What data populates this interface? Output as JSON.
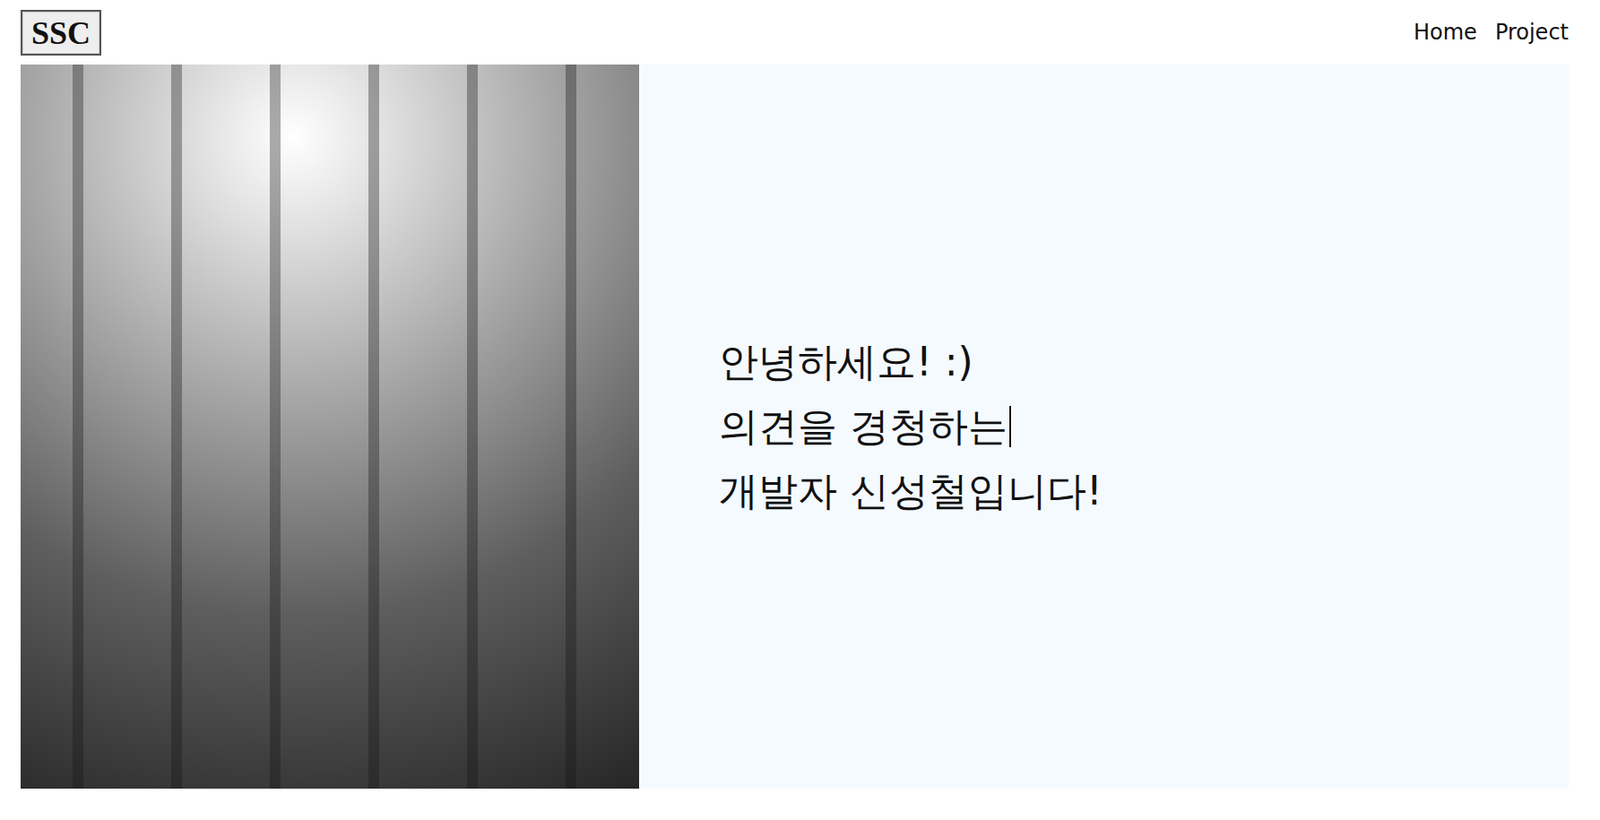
{
  "logo": "SSC",
  "nav": [
    {
      "label": "Home"
    },
    {
      "label": "Project"
    }
  ],
  "hero": {
    "lines": [
      {
        "text": "안녕하세요! :)",
        "cursor": false
      },
      {
        "text": "의견을 경청하는",
        "cursor": true
      },
      {
        "text": "개발자 신성철입니다!",
        "cursor": false
      }
    ]
  }
}
